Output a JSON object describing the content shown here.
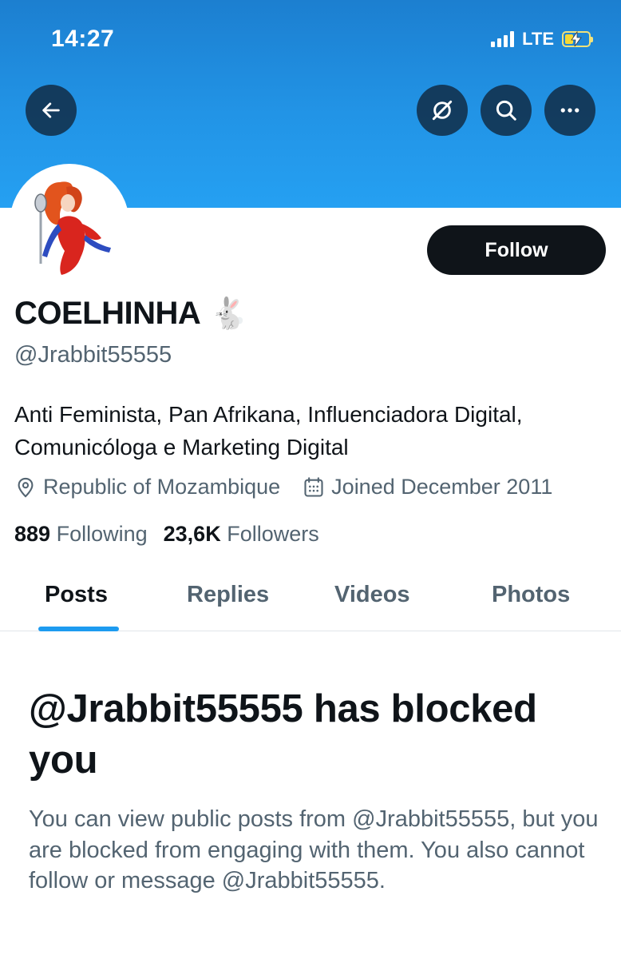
{
  "status_bar": {
    "time": "14:27",
    "network": "LTE",
    "battery_level": 0.35,
    "battery_charging": true,
    "battery_color": "#f5d836"
  },
  "header": {
    "back_icon": "arrow-left-icon",
    "grok_icon": "grok-icon",
    "search_icon": "search-icon",
    "more_icon": "more-horizontal-icon"
  },
  "colors": {
    "banner_top": "#1c7fd0",
    "banner_bottom": "#25a0f2",
    "accent": "#1d9bf0",
    "text_primary": "#0f1419",
    "text_secondary": "#536471"
  },
  "profile": {
    "display_name": "COELHINHA",
    "name_emoji": "🐇",
    "handle": "@Jrabbit55555",
    "follow_label": "Follow",
    "bio": "Anti Feminista, Pan Afrikana, Influenciadora Digital, Comunicóloga e Marketing Digital",
    "location": "Republic of Mozambique",
    "joined": "Joined December 2011",
    "following_count": "889",
    "following_label": "Following",
    "followers_count": "23,6K",
    "followers_label": "Followers"
  },
  "tabs": [
    {
      "label": "Posts",
      "active": true
    },
    {
      "label": "Replies",
      "active": false
    },
    {
      "label": "Videos",
      "active": false
    },
    {
      "label": "Photos",
      "active": false
    }
  ],
  "blocked_notice": {
    "title": "@Jrabbit55555 has blocked you",
    "description": "You can view public posts from @Jrabbit55555, but you are blocked from engaging with them. You also cannot follow or message @Jrabbit55555."
  }
}
